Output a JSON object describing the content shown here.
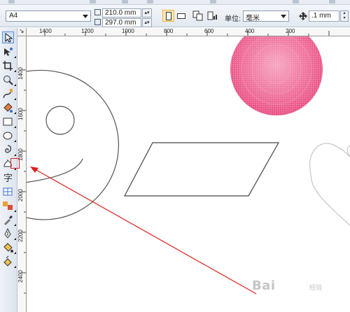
{
  "property_bar": {
    "paper_size": "A4",
    "width": "210.0 mm",
    "height": "297.0 mm",
    "units_label": "单位:",
    "units_value": "毫米",
    "nudge_value": ".1 mm"
  },
  "toolbox": {
    "tools": [
      {
        "name": "pick-tool-icon"
      },
      {
        "name": "shape-tool-icon"
      },
      {
        "name": "crop-tool-icon"
      },
      {
        "name": "zoom-tool-icon"
      },
      {
        "name": "freehand-tool-icon"
      },
      {
        "name": "smart-fill-tool-icon"
      },
      {
        "name": "rectangle-tool-icon"
      },
      {
        "name": "ellipse-tool-icon"
      },
      {
        "name": "polygon-tool-icon"
      },
      {
        "name": "basic-shapes-tool-icon"
      },
      {
        "name": "text-tool-icon"
      },
      {
        "name": "table-tool-icon"
      },
      {
        "name": "interactive-blend-tool-icon"
      },
      {
        "name": "eyedropper-tool-icon"
      },
      {
        "name": "outline-pen-tool-icon"
      },
      {
        "name": "fill-tool-icon"
      },
      {
        "name": "interactive-fill-tool-icon"
      }
    ]
  },
  "rulers": {
    "horizontal_labels": [
      "1400",
      "1200",
      "1000",
      "800",
      "600",
      "400",
      "200"
    ],
    "vertical_labels": [
      "1400",
      "1600",
      "1800",
      "2000",
      "2200",
      "2400"
    ],
    "corner_symbol": "↘"
  },
  "watermark": {
    "text": "Bai",
    "suffix": "经验"
  },
  "colors": {
    "pink_fill": "#ee5a8a",
    "shape_stroke": "#444444",
    "heart_stroke": "#bbbbbb",
    "annotation_red": "#e0201a",
    "selected_tool": "#cfe0f7"
  }
}
